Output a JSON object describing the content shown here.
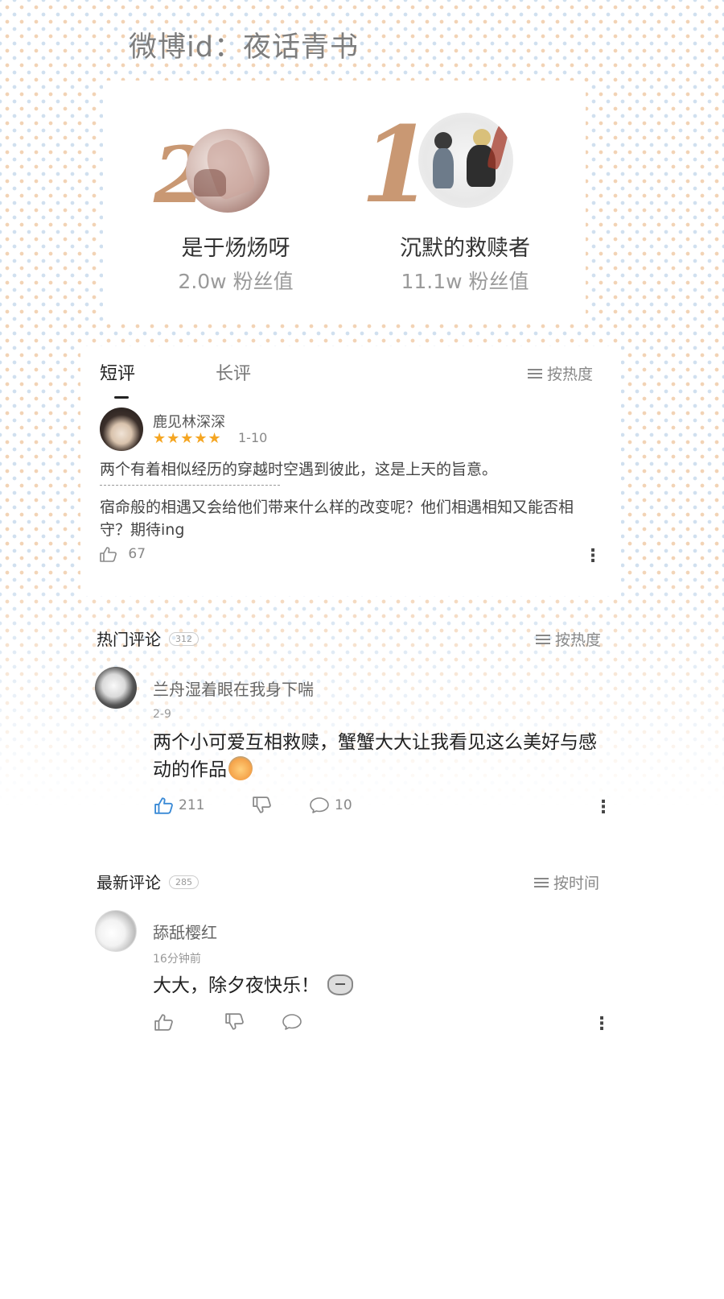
{
  "header": {
    "weibo_id": "微博id：夜话青书"
  },
  "fan_ranking": [
    {
      "rank": "2",
      "name": "是于炀炀呀",
      "fans": "2.0w 粉丝值"
    },
    {
      "rank": "1",
      "name": "沉默的救赎者",
      "fans": "11.1w 粉丝值"
    }
  ],
  "review_section": {
    "tabs": [
      {
        "label": "短评",
        "active": true
      },
      {
        "label": "长评",
        "active": false
      }
    ],
    "sort_label": "按热度",
    "review": {
      "author": "鹿见林深深",
      "rating_stars": 5,
      "rating_text": "★★★★★",
      "chapter_range": "1-10",
      "line1": "两个有着相似经历的穿越时空遇到彼此，这是上天的旨意。",
      "line2": "宿命般的相遇又会给他们带来什么样的改变呢？他们相遇相知又能否相守？期待ing",
      "likes": "67"
    }
  },
  "hot_comments": {
    "title": "热门评论",
    "count": "312",
    "sort_label": "按热度",
    "comment": {
      "author": "兰舟湿着眼在我身下喘",
      "time": "2-9",
      "text": "两个小可爱互相救赎，蟹蟹大大让我看见这么美好与感动的作品",
      "likes": "211",
      "replies": "10"
    }
  },
  "new_comments": {
    "title": "最新评论",
    "count": "285",
    "sort_label": "按时间",
    "comment": {
      "author": "舔舐樱红",
      "time": "16分钟前",
      "text": "大大，除夕夜快乐！"
    }
  },
  "icons": {
    "accent_rank_color": "#c99873",
    "star_color": "#f5a623",
    "like_active_color": "#3a8ad6"
  }
}
